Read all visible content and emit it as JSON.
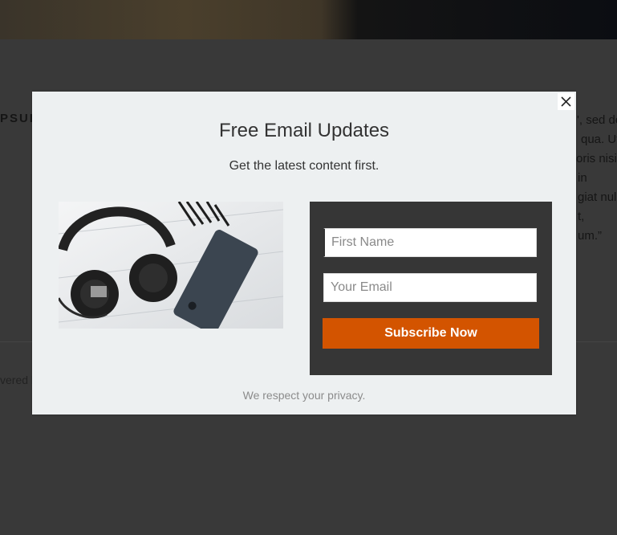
{
  "background": {
    "heading_fragment": "PSUI",
    "text_lines": [
      "', sed do",
      "qua. Ut",
      "oris nisi",
      "in",
      "giat nul",
      "t,",
      "um.”"
    ],
    "footer_fragment": "vered b"
  },
  "popup": {
    "close_label": "✕",
    "title": "Free Email Updates",
    "subtitle": "Get the latest content first.",
    "first_name_placeholder": "First Name",
    "email_placeholder": "Your Email",
    "subscribe_label": "Subscribe Now",
    "privacy_note": "We respect your privacy.",
    "image_description_icon": "headphones-phone-photo"
  },
  "colors": {
    "overlay": "#393939",
    "popup_bg": "#edf0f1",
    "form_panel": "#363636",
    "button": "#d35400"
  }
}
